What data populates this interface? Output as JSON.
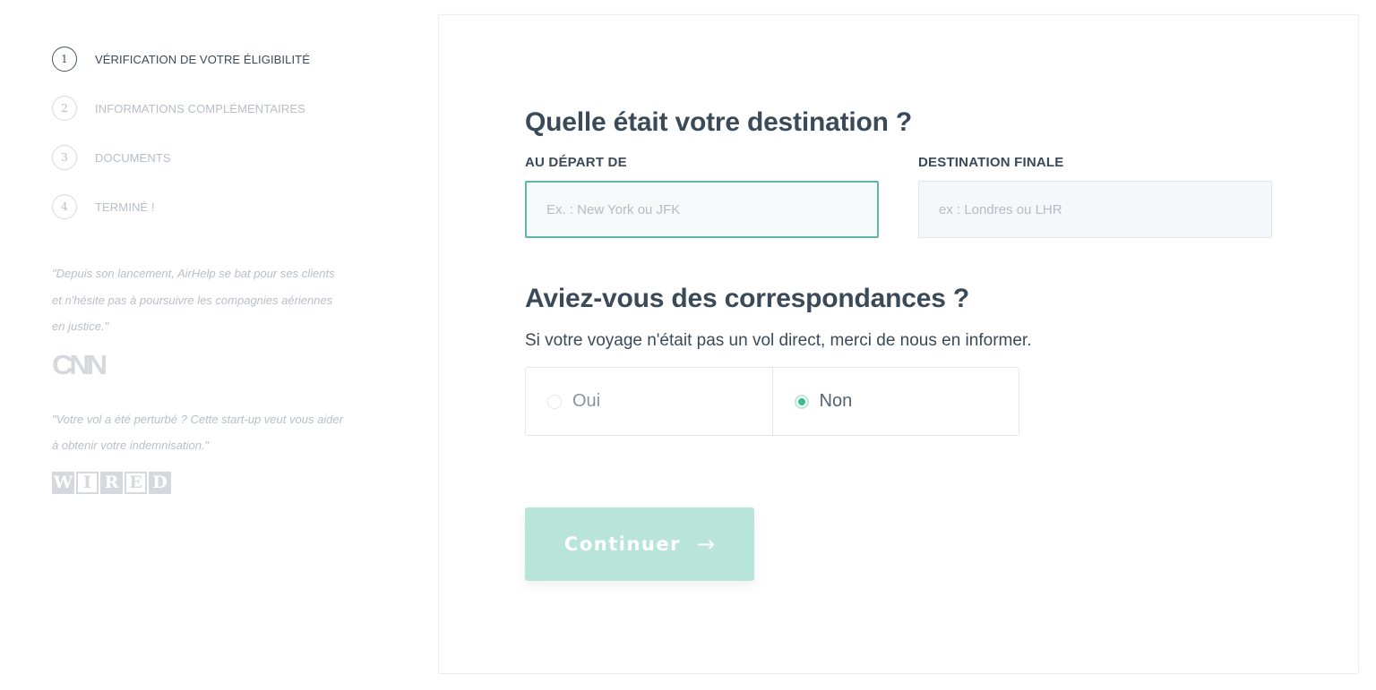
{
  "sidebar": {
    "steps": [
      {
        "number": "1",
        "label": "VÉRIFICATION DE VOTRE ÉLIGIBILITÉ",
        "active": true
      },
      {
        "number": "2",
        "label": "INFORMATIONS COMPLÉMENTAIRES",
        "active": false
      },
      {
        "number": "3",
        "label": "DOCUMENTS",
        "active": false
      },
      {
        "number": "4",
        "label": "TERMINÉ !",
        "active": false
      }
    ],
    "quotes": [
      {
        "text": "\"Depuis son lancement, AirHelp se bat pour ses clients et n'hésite pas à poursuivre les compagnies aériennes en justice.\"",
        "source": "CNN"
      },
      {
        "text": "\"Votre vol a été perturbé ? Cette start-up veut vous aider à obtenir votre indemnisation.\"",
        "source": "WIRED"
      }
    ],
    "wired_letters": [
      "W",
      "I",
      "R",
      "E",
      "D"
    ]
  },
  "form": {
    "destination_title": "Quelle était votre destination ?",
    "departure": {
      "label": "AU DÉPART DE",
      "placeholder": "Ex. : New York ou JFK",
      "value": ""
    },
    "arrival": {
      "label": "DESTINATION FINALE",
      "placeholder": "ex : Londres ou LHR",
      "value": ""
    },
    "connections_title": "Aviez-vous des correspondances ?",
    "connections_subtitle": "Si votre voyage n'était pas un vol direct, merci de nous en informer.",
    "options": [
      {
        "label": "Oui",
        "selected": false
      },
      {
        "label": "Non",
        "selected": true
      }
    ],
    "continue_label": "Continuer",
    "continue_icon": "→"
  },
  "colors": {
    "accent": "#33c08f",
    "button_bg": "#b9e4da",
    "focus_border": "#5fb8a4",
    "heading": "#3b4a58"
  }
}
